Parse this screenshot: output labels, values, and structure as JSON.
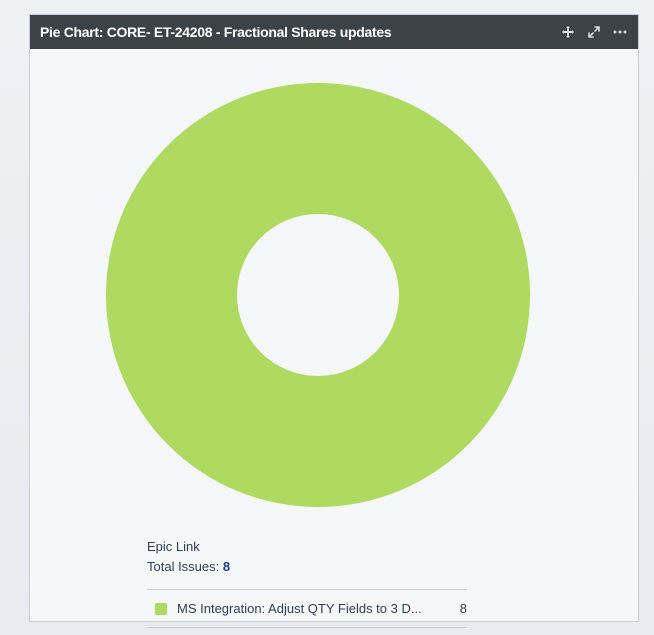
{
  "gadget": {
    "title": "Pie Chart: CORE- ET-24208 - Fractional Shares updates",
    "header_actions": [
      {
        "name": "move-icon",
        "symbol": "✥"
      },
      {
        "name": "expand-icon",
        "symbol": "⤢"
      },
      {
        "name": "more-icon",
        "symbol": "•••"
      }
    ]
  },
  "chart_data": {
    "type": "pie",
    "categories": [
      "MS Integration: Adjust QTY Fields to 3 D..."
    ],
    "values": [
      8
    ],
    "colors": [
      "#aeda62"
    ],
    "donut": true
  },
  "legend": {
    "field_label": "Epic Link",
    "total_label": "Total Issues:",
    "total_value": "8",
    "items": [
      {
        "label": "MS Integration: Adjust QTY Fields to 3 D...",
        "count": "8",
        "color": "#aeda62"
      }
    ]
  }
}
